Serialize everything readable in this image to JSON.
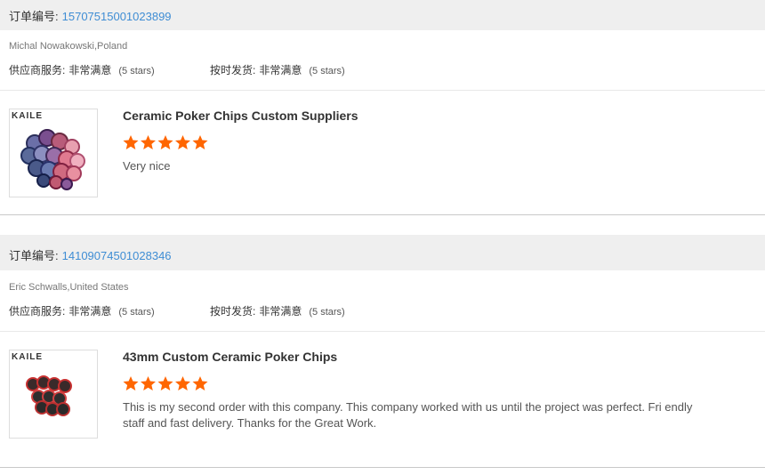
{
  "labels": {
    "order_number": "订单编号:",
    "supplier_service": "供应商服务:",
    "on_time_delivery": "按时发货:"
  },
  "colors": {
    "star": "#ff6600",
    "order_link": "#3f8dd4",
    "header_bg": "#efefef"
  },
  "orders": [
    {
      "order_no": "15707515001023899",
      "buyer": "Michal Nowakowski,Poland",
      "supplier_service": {
        "value": "非常满意",
        "stars": "(5 stars)"
      },
      "on_time_delivery": {
        "value": "非常满意",
        "stars": "(5 stars)"
      },
      "product": {
        "brand": "KAILE",
        "title": "Ceramic Poker Chips Custom Suppliers",
        "rating": 5,
        "review": "Very nice"
      }
    },
    {
      "order_no": "14109074501028346",
      "buyer": "Eric Schwalls,United States",
      "supplier_service": {
        "value": "非常满意",
        "stars": "(5 stars)"
      },
      "on_time_delivery": {
        "value": "非常满意",
        "stars": "(5 stars)"
      },
      "product": {
        "brand": "KAILE",
        "title": "43mm Custom Ceramic Poker Chips",
        "rating": 5,
        "review": "This is my second order with this company.  This company worked with us until the project was perfect.  Fri endly staff and fast delivery.  Thanks for the Great Work."
      }
    }
  ]
}
